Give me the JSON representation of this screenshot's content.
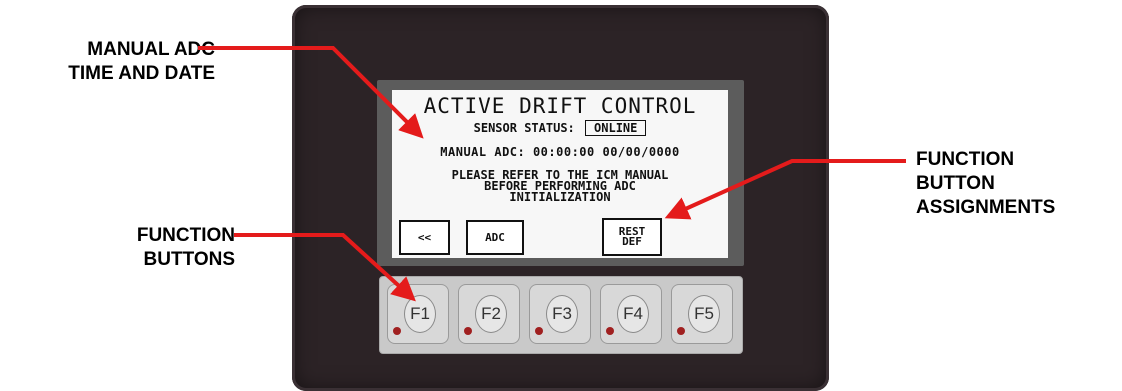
{
  "annotations": {
    "manual_adc": "MANUAL ADC\nTIME AND DATE",
    "function_buttons": "FUNCTION\nBUTTONS",
    "function_button_assignments": "FUNCTION\nBUTTON\nASSIGNMENTS"
  },
  "screen": {
    "title": "ACTIVE DRIFT CONTROL",
    "sensor_status_label": "SENSOR STATUS:",
    "sensor_status_value": "ONLINE",
    "manual_adc_line": "MANUAL ADC: 00:00:00 00/00/0000",
    "message": "PLEASE REFER TO THE ICM MANUAL\nBEFORE PERFORMING ADC\nINITIALIZATION",
    "softkeys": [
      "<<",
      "ADC",
      "REST\nDEF"
    ]
  },
  "keys": [
    "F1",
    "F2",
    "F3",
    "F4",
    "F5"
  ],
  "colors": {
    "arrow": "#e41b1b",
    "housing": "#2c2326",
    "bezel": "#5c5c5c",
    "led": "#a02020"
  }
}
